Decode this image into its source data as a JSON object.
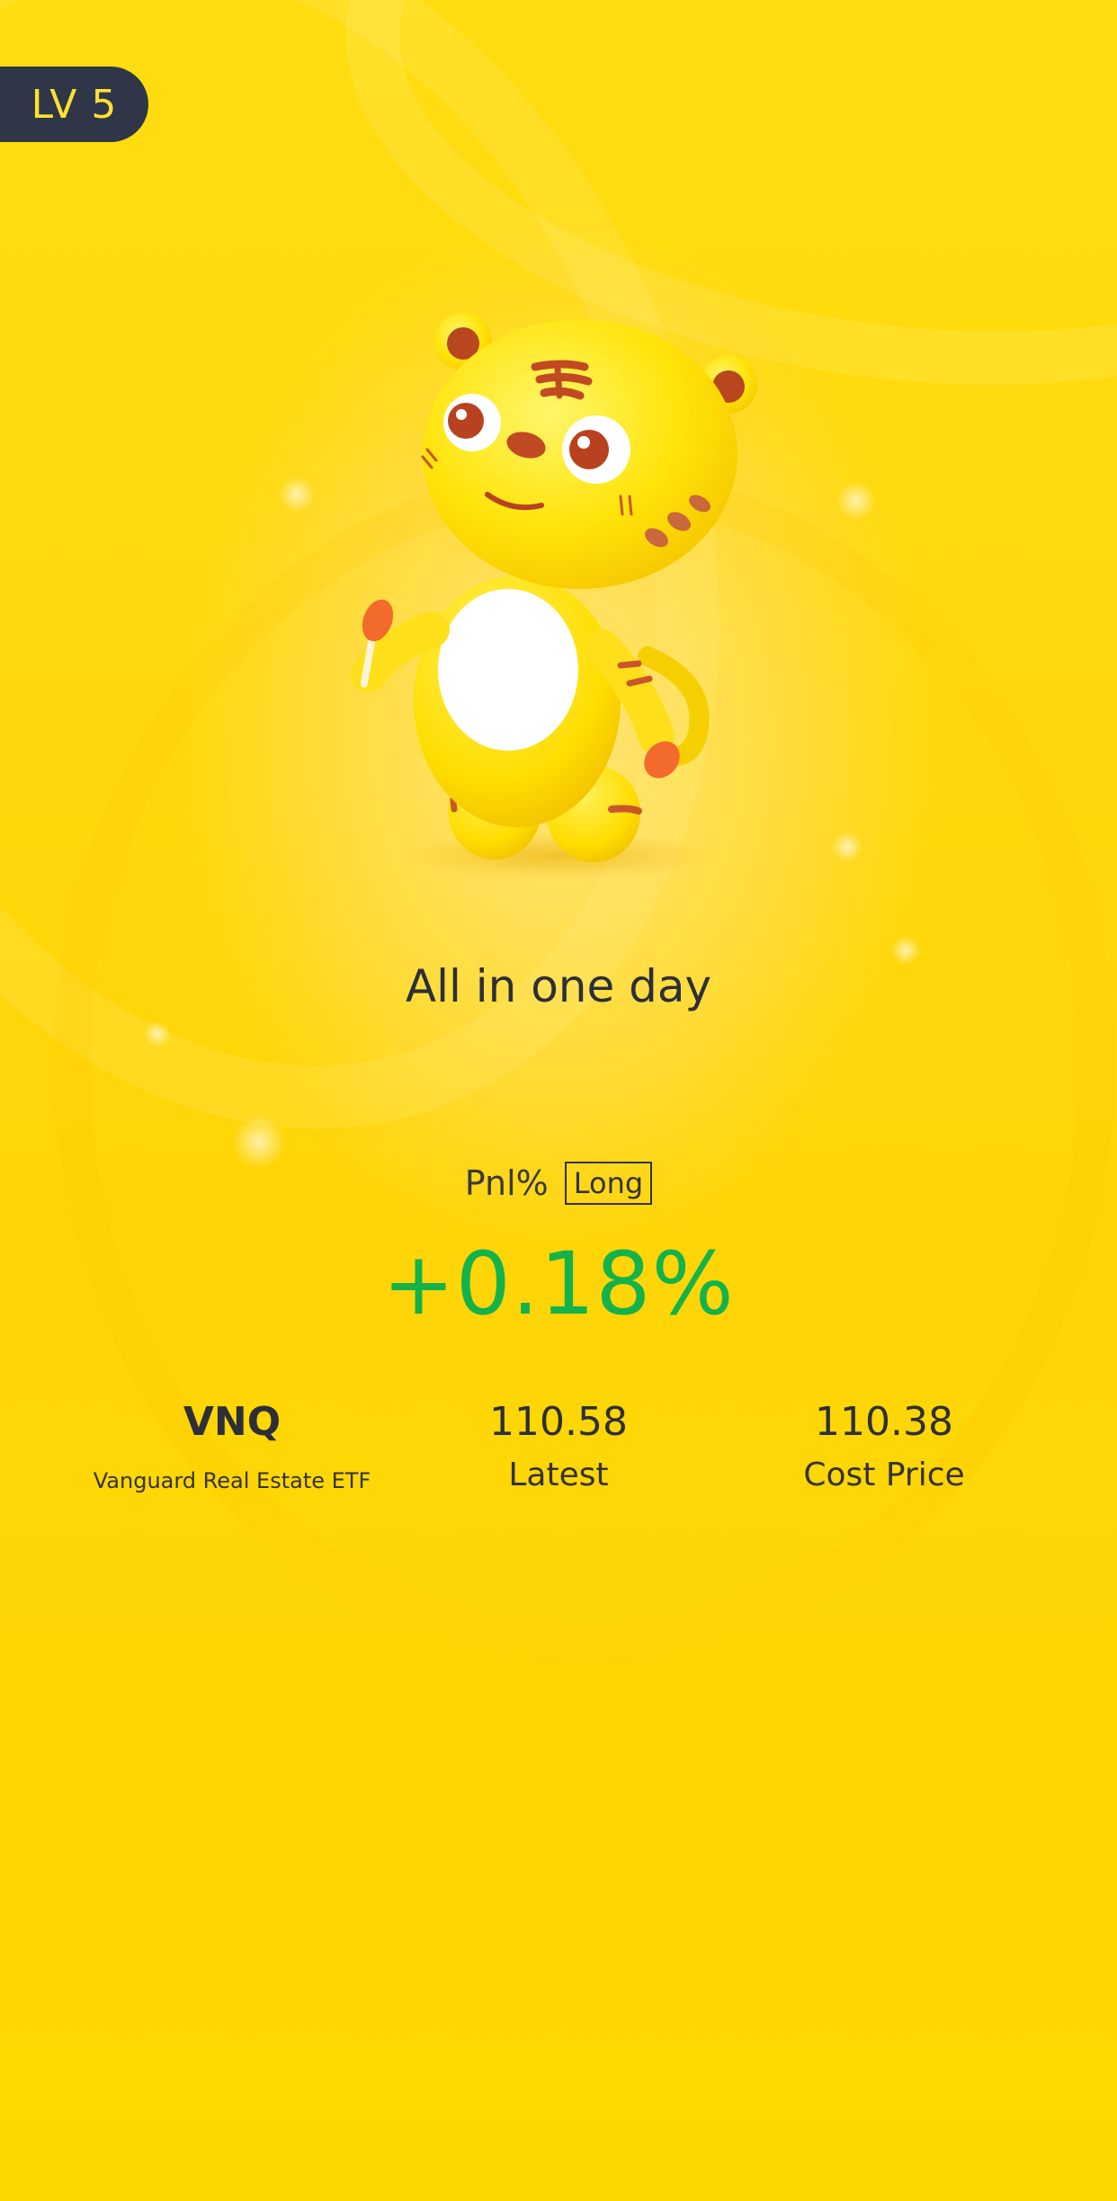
{
  "level_badge": {
    "label": "LV 5"
  },
  "title": "All in one day",
  "pnl": {
    "label": "Pnl%",
    "position_tag": "Long",
    "value": "+0.18%",
    "value_color": "#14b24b"
  },
  "stats": {
    "symbol": "VNQ",
    "symbol_name": "Vanguard Real Estate ETF",
    "latest_value": "110.58",
    "latest_label": "Latest",
    "cost_value": "110.38",
    "cost_label": "Cost Price"
  },
  "theme": {
    "background": "#ffd508",
    "badge_bg": "#2f3647",
    "badge_text": "#ffe033",
    "text_dark": "#2c2f38"
  },
  "mascot": {
    "icon": "tiger-mascot-icon"
  }
}
